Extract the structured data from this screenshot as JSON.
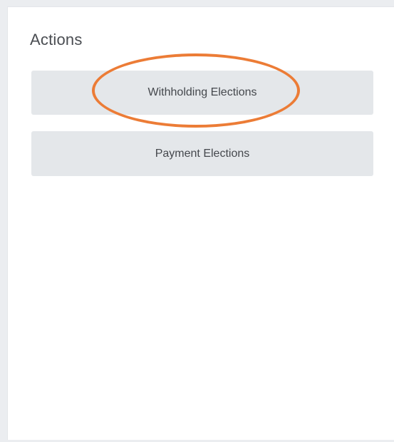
{
  "panel": {
    "title": "Actions",
    "actions": [
      {
        "label": "Withholding Elections"
      },
      {
        "label": "Payment Elections"
      }
    ]
  },
  "highlight": {
    "target": "Withholding Elections",
    "color": "#ec7c36"
  },
  "colors": {
    "background": "#ebedf0",
    "panel": "#ffffff",
    "button": "#e4e7ea",
    "text": "#45484d"
  }
}
